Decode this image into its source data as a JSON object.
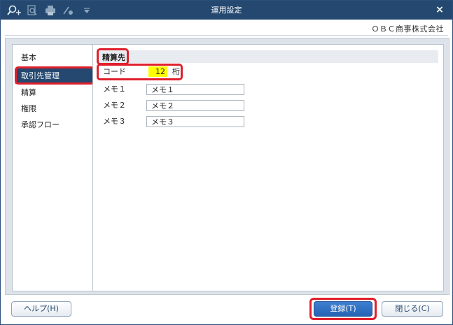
{
  "window": {
    "title": "運用設定",
    "company": "ＯＢＣ商事株式会社",
    "titlebar_color": "#24486f"
  },
  "toolbar": {
    "icons": [
      "search-plus-icon",
      "search-document-icon",
      "print-icon",
      "export-tool-icon",
      "dropdown-arrow-icon"
    ],
    "close_label": "×"
  },
  "sidebar": {
    "items": [
      {
        "label": "基本",
        "active": false
      },
      {
        "label": "取引先管理",
        "active": true
      },
      {
        "label": "精算",
        "active": false
      },
      {
        "label": "権限",
        "active": false
      },
      {
        "label": "承認フロー",
        "active": false
      }
    ]
  },
  "panel": {
    "section_title": "精算先",
    "code": {
      "label": "コード",
      "value": "12",
      "unit": "桁"
    },
    "memos": [
      {
        "label": "メモ１",
        "value": "メモ１"
      },
      {
        "label": "メモ２",
        "value": "メモ２"
      },
      {
        "label": "メモ３",
        "value": "メモ３"
      }
    ]
  },
  "buttons": {
    "help": "ヘルプ(H)",
    "register": "登録(T)",
    "close": "閉じる(C)"
  },
  "highlight_color": "#e0202c"
}
